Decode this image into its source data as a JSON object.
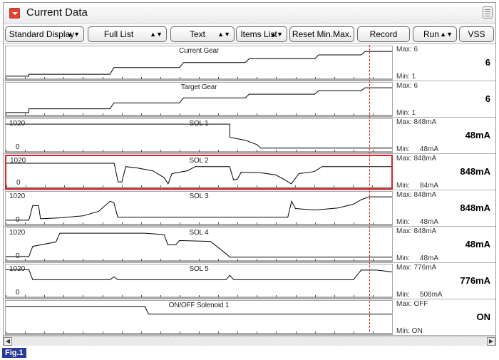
{
  "window": {
    "title": "Current Data"
  },
  "toolbar": {
    "buttons": [
      {
        "label": "Standard Display",
        "dropdown": true
      },
      {
        "label": "Full List",
        "dropdown": true
      },
      {
        "label": "Text",
        "dropdown": true
      },
      {
        "label": "Items List",
        "dropdown": true
      },
      {
        "label": "Reset Min.Max.",
        "dropdown": false
      },
      {
        "label": "Record",
        "dropdown": false
      },
      {
        "label": "Run",
        "dropdown": true
      },
      {
        "label": "VSS",
        "dropdown": false
      }
    ]
  },
  "graphs": [
    {
      "name": "Current Gear",
      "axis_top": "",
      "axis_bottom": "",
      "max": "Max: 6",
      "min": "Min: 1",
      "current": "6",
      "selected": false,
      "trace": [
        [
          0,
          0.95
        ],
        [
          0.06,
          0.95
        ],
        [
          0.06,
          0.88
        ],
        [
          0.27,
          0.88
        ],
        [
          0.28,
          0.65
        ],
        [
          0.45,
          0.65
        ],
        [
          0.46,
          0.48
        ],
        [
          0.62,
          0.48
        ],
        [
          0.63,
          0.35
        ],
        [
          0.8,
          0.35
        ],
        [
          0.81,
          0.22
        ],
        [
          0.92,
          0.22
        ],
        [
          0.93,
          0.1
        ],
        [
          1,
          0.1
        ]
      ]
    },
    {
      "name": "Target Gear",
      "axis_top": "",
      "axis_bottom": "",
      "max": "Max: 6",
      "min": "Min: 1",
      "current": "6",
      "selected": false,
      "trace": [
        [
          0,
          0.95
        ],
        [
          0.06,
          0.95
        ],
        [
          0.06,
          0.82
        ],
        [
          0.27,
          0.82
        ],
        [
          0.28,
          0.62
        ],
        [
          0.45,
          0.62
        ],
        [
          0.46,
          0.45
        ],
        [
          0.62,
          0.45
        ],
        [
          0.63,
          0.32
        ],
        [
          0.8,
          0.32
        ],
        [
          0.81,
          0.2
        ],
        [
          0.92,
          0.2
        ],
        [
          0.93,
          0.1
        ],
        [
          1,
          0.1
        ]
      ]
    },
    {
      "name": "SOL 1",
      "axis_top": "1020",
      "axis_bottom": "0",
      "max": "Max:   848mA",
      "min": "Min:",
      "min_value": "48mA",
      "current": "48mA",
      "selected": false,
      "trace": [
        [
          0,
          0.1
        ],
        [
          0.58,
          0.1
        ],
        [
          0.58,
          0.55
        ],
        [
          0.62,
          0.65
        ],
        [
          0.65,
          0.8
        ],
        [
          0.66,
          0.92
        ],
        [
          1,
          0.92
        ]
      ]
    },
    {
      "name": "SOL 2",
      "axis_top": "1020",
      "axis_bottom": "0",
      "max": "Max:   848mA",
      "min": "Min:",
      "min_value": "84mA",
      "current": "848mA",
      "selected": true,
      "trace": [
        [
          0,
          0.18
        ],
        [
          0.28,
          0.18
        ],
        [
          0.29,
          0.85
        ],
        [
          0.3,
          0.85
        ],
        [
          0.31,
          0.3
        ],
        [
          0.34,
          0.35
        ],
        [
          0.38,
          0.45
        ],
        [
          0.41,
          0.7
        ],
        [
          0.42,
          0.92
        ],
        [
          0.43,
          0.55
        ],
        [
          0.47,
          0.45
        ],
        [
          0.48,
          0.38
        ],
        [
          0.49,
          0.3
        ],
        [
          0.58,
          0.3
        ],
        [
          0.59,
          0.78
        ],
        [
          0.6,
          0.75
        ],
        [
          0.61,
          0.5
        ],
        [
          0.66,
          0.52
        ],
        [
          0.7,
          0.6
        ],
        [
          0.72,
          0.75
        ],
        [
          0.74,
          0.92
        ],
        [
          0.76,
          0.55
        ],
        [
          0.8,
          0.48
        ],
        [
          0.82,
          0.3
        ],
        [
          1,
          0.3
        ]
      ]
    },
    {
      "name": "SOL 3",
      "axis_top": "1020",
      "axis_bottom": "0",
      "max": "Max:   848mA",
      "min": "Min:",
      "min_value": "48mA",
      "current": "848mA",
      "selected": false,
      "trace": [
        [
          0,
          0.9
        ],
        [
          0.06,
          0.9
        ],
        [
          0.07,
          0.4
        ],
        [
          0.085,
          0.4
        ],
        [
          0.09,
          0.85
        ],
        [
          0.14,
          0.82
        ],
        [
          0.2,
          0.75
        ],
        [
          0.24,
          0.6
        ],
        [
          0.27,
          0.25
        ],
        [
          0.28,
          0.3
        ],
        [
          0.29,
          0.8
        ],
        [
          0.73,
          0.8
        ],
        [
          0.74,
          0.25
        ],
        [
          0.75,
          0.5
        ],
        [
          0.8,
          0.55
        ],
        [
          0.86,
          0.48
        ],
        [
          0.9,
          0.35
        ],
        [
          0.92,
          0.2
        ],
        [
          0.94,
          0.1
        ],
        [
          1,
          0.1
        ]
      ]
    },
    {
      "name": "SOL 4",
      "axis_top": "1020",
      "axis_bottom": "0",
      "max": "Max:   848mA",
      "min": "Min:",
      "min_value": "48mA",
      "current": "48mA",
      "selected": false,
      "trace": [
        [
          0,
          0.9
        ],
        [
          0.06,
          0.9
        ],
        [
          0.07,
          0.55
        ],
        [
          0.13,
          0.4
        ],
        [
          0.14,
          0.1
        ],
        [
          0.36,
          0.1
        ],
        [
          0.41,
          0.15
        ],
        [
          0.42,
          0.5
        ],
        [
          0.44,
          0.5
        ],
        [
          0.45,
          0.35
        ],
        [
          0.53,
          0.38
        ],
        [
          0.57,
          0.8
        ],
        [
          0.58,
          0.92
        ],
        [
          1,
          0.92
        ]
      ]
    },
    {
      "name": "SOL 5",
      "axis_top": "1020",
      "axis_bottom": "0",
      "max": "Max:   776mA",
      "min": "Min:",
      "min_value": "508mA",
      "current": "776mA",
      "selected": false,
      "trace": [
        [
          0,
          0.1
        ],
        [
          0.06,
          0.1
        ],
        [
          0.07,
          0.45
        ],
        [
          0.27,
          0.45
        ],
        [
          0.28,
          0.35
        ],
        [
          0.29,
          0.45
        ],
        [
          0.57,
          0.45
        ],
        [
          0.58,
          0.3
        ],
        [
          0.59,
          0.45
        ],
        [
          0.9,
          0.45
        ],
        [
          0.92,
          0.12
        ],
        [
          0.96,
          0.12
        ],
        [
          1,
          0.18
        ]
      ]
    },
    {
      "name": "ON/OFF Solenoid 1",
      "axis_top": "",
      "axis_bottom": "",
      "max": "Max: OFF",
      "min": "Min: ON",
      "current": "ON",
      "selected": false,
      "trace": [
        [
          0,
          0.12
        ],
        [
          0.36,
          0.12
        ],
        [
          0.37,
          0.38
        ],
        [
          1,
          0.38
        ]
      ]
    }
  ],
  "figure_label": "Fig.1",
  "colors": {
    "accent": "#d7262b",
    "figure_label_bg": "#2a3a9a",
    "trace": "#000000"
  },
  "icons": {
    "collapse": "collapse-arrow-icon",
    "menu": "list-menu-icon",
    "scroll_left": "scroll-left-icon",
    "scroll_right": "scroll-right-icon"
  }
}
